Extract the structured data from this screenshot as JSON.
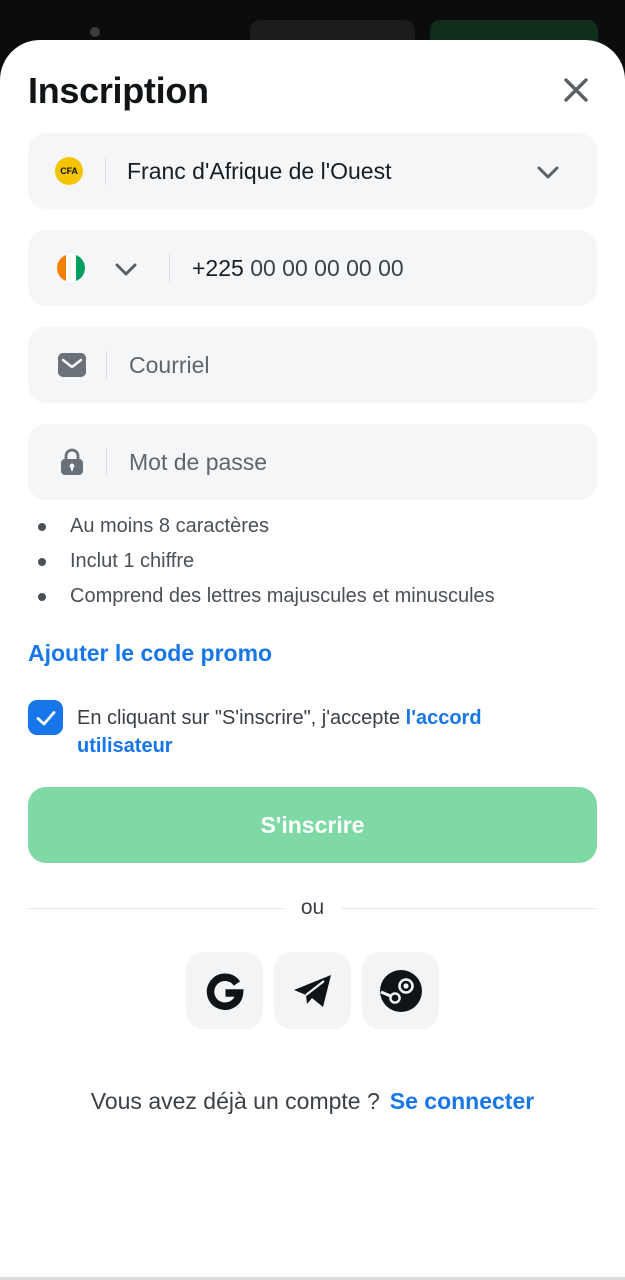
{
  "header": {
    "title": "Inscription"
  },
  "currency": {
    "badge": "CFA",
    "value": "Franc d'Afrique de l'Ouest"
  },
  "phone": {
    "prefix": "+225",
    "placeholder": "00 00 00 00 00"
  },
  "email": {
    "placeholder": "Courriel"
  },
  "password": {
    "placeholder": "Mot de passe"
  },
  "password_rules": [
    "Au moins 8 caractères",
    "Inclut 1 chiffre",
    "Comprend des lettres majuscules et minuscules"
  ],
  "promo": {
    "label": "Ajouter le code promo"
  },
  "agreement": {
    "checked": true,
    "text": "En cliquant sur \"S'inscrire\", j'accepte ",
    "link": "l'accord utilisateur"
  },
  "submit": {
    "label": "S'inscrire"
  },
  "divider": {
    "label": "ou"
  },
  "social": {
    "items": [
      {
        "icon": "google-icon"
      },
      {
        "icon": "telegram-icon"
      },
      {
        "icon": "steam-icon"
      }
    ]
  },
  "footer": {
    "question": "Vous avez déjà un compte ?",
    "link": "Se connecter"
  },
  "colors": {
    "accent": "#1676ea",
    "submit_disabled": "#7fd9a5",
    "field_bg": "#f5f6f7",
    "cfa_badge": "#f5c400"
  }
}
